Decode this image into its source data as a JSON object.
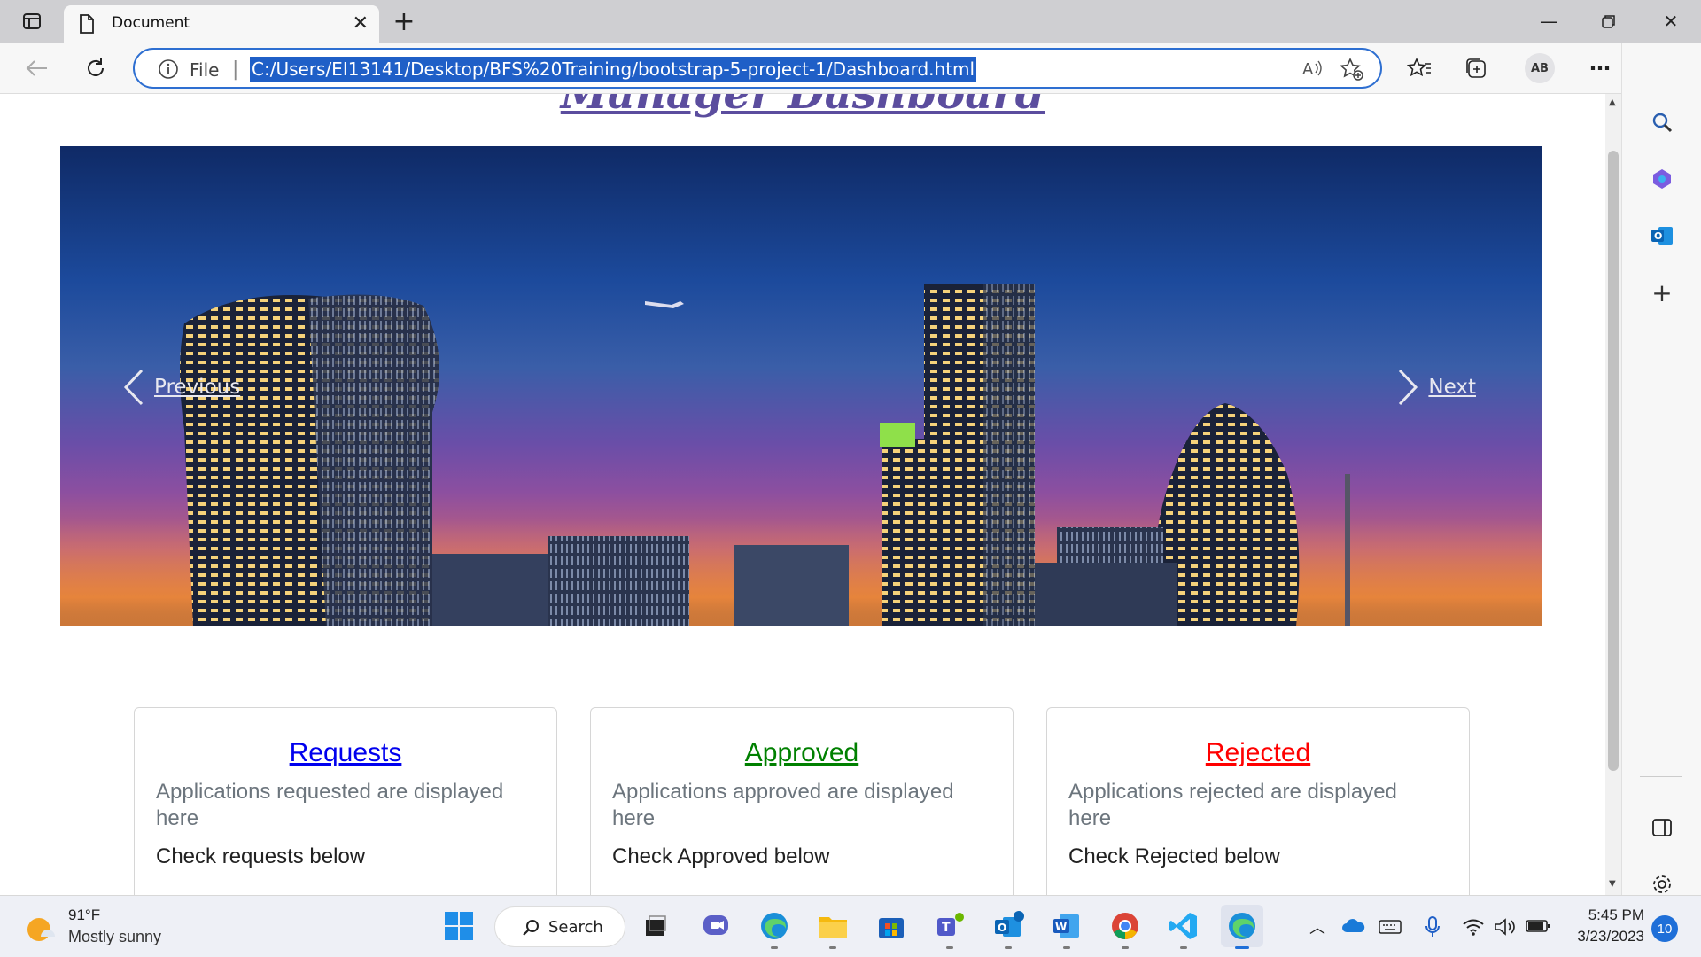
{
  "browser": {
    "tab_title": "Document",
    "address_prefix": "File",
    "url": "C:/Users/EI13141/Desktop/BFS%20Training/bootstrap-5-project-1/Dashboard.html",
    "profile_initials": "AB"
  },
  "page": {
    "title": "Manager Dashboard",
    "carousel": {
      "prev_label": "Previous",
      "next_label": "Next"
    },
    "cards": [
      {
        "title": "Requests",
        "color": "#0000ee",
        "text": "Applications requested are displayed here",
        "check": "Check requests below"
      },
      {
        "title": "Approved",
        "color": "#008000",
        "text": "Applications approved are displayed here",
        "check": "Check Approved below"
      },
      {
        "title": "Rejected",
        "color": "#ff0000",
        "text": "Applications rejected are displayed here",
        "check": "Check Rejected below"
      }
    ]
  },
  "taskbar": {
    "weather_temp": "91°F",
    "weather_desc": "Mostly sunny",
    "search_label": "Search",
    "time": "5:45 PM",
    "date": "3/23/2023",
    "notification_count": "10"
  },
  "colors": {
    "accent": "#1f5fc7",
    "title_purple": "#5b4d9e"
  }
}
